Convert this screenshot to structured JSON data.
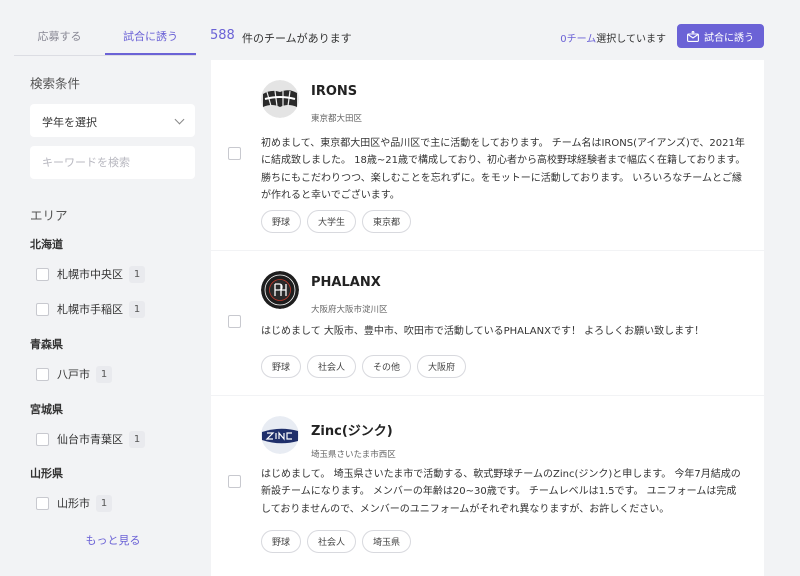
{
  "tabs": [
    "応募する",
    "試合に誘う"
  ],
  "filters": {
    "title": "検索条件",
    "grade_select": "学年を選択",
    "keyword_placeholder": "キーワードを検索",
    "area_title": "エリア"
  },
  "areas": [
    {
      "pref": "北海道",
      "cities": [
        {
          "name": "札幌市中央区",
          "count": "1"
        },
        {
          "name": "札幌市手稲区",
          "count": "1"
        }
      ]
    },
    {
      "pref": "青森県",
      "cities": [
        {
          "name": "八戸市",
          "count": "1"
        }
      ]
    },
    {
      "pref": "宮城県",
      "cities": [
        {
          "name": "仙台市青葉区",
          "count": "1"
        }
      ]
    },
    {
      "pref": "山形県",
      "cities": [
        {
          "name": "山形市",
          "count": "1"
        }
      ]
    }
  ],
  "more_label": "もっと見る",
  "header": {
    "count": "588",
    "count_text": "件のチームがあります",
    "selected_count": "0チーム",
    "selected_text": "選択しています",
    "invite_button": "試合に誘う"
  },
  "teams": [
    {
      "name": "IRONS",
      "location": "東京都大田区",
      "description": "初めまして、東京都大田区や品川区で主に活動をしております。 チーム名はIRONS(アイアンズ)で、2021年に結成致しました。 18歳~21歳で構成しており、初心者から高校野球経験者まで幅広く在籍しております。 勝ちにもこだわりつつ、楽しむことを忘れずに。をモットーに活動しております。 いろいろなチームとご縁が作れると幸いでございます。",
      "tags": [
        "野球",
        "大学生",
        "東京都"
      ]
    },
    {
      "name": "PHALANX",
      "location": "大阪府大阪市淀川区",
      "description": "はじめまして 大阪市、豊中市、吹田市で活動しているPHALANXです！ よろしくお願い致します！",
      "tags": [
        "野球",
        "社会人",
        "その他",
        "大阪府"
      ]
    },
    {
      "name": "Zinc(ジンク)",
      "location": "埼玉県さいたま市西区",
      "description": "はじめまして。 埼玉県さいたま市で活動する、軟式野球チームのZinc(ジンク)と申します。 今年7月結成の新設チームになります。 メンバーの年齢は20~30歳です。 チームレベルは1.5です。 ユニフォームは完成しておりませんので、メンバーのユニフォームがそれぞれ異なりますが、お許しください。",
      "tags": [
        "野球",
        "社会人",
        "埼玉県"
      ]
    }
  ],
  "colors": {
    "accent": "#6b62d6",
    "background": "#f2f3f5"
  }
}
